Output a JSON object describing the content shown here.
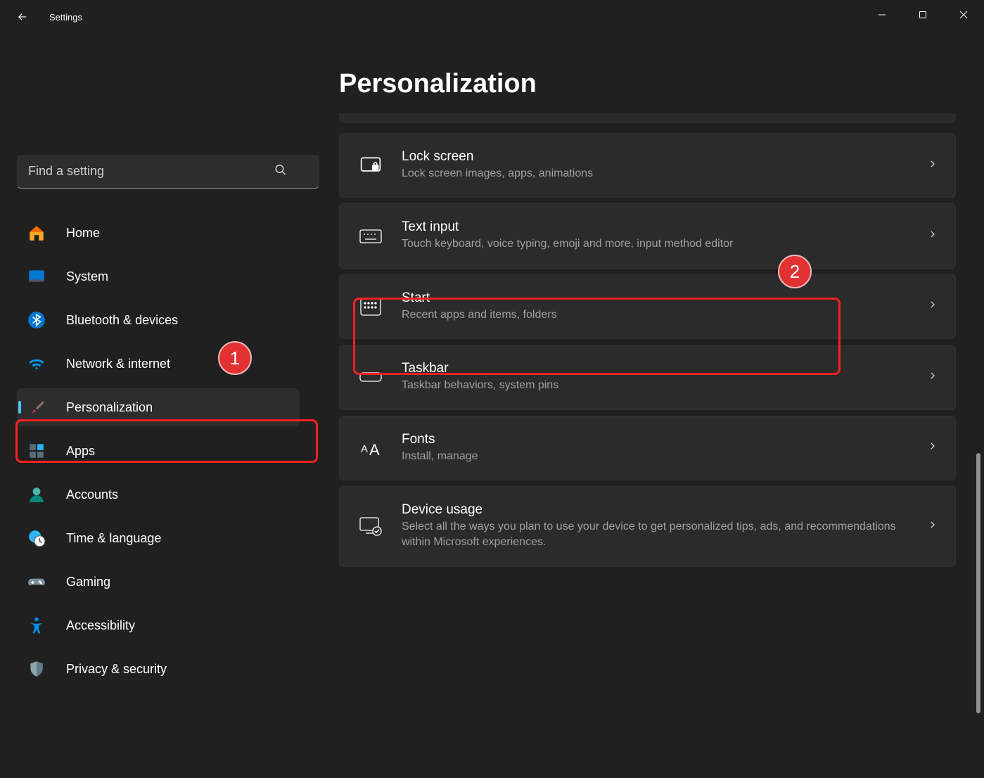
{
  "app": {
    "title": "Settings"
  },
  "search": {
    "placeholder": "Find a setting"
  },
  "sidebar": {
    "items": [
      {
        "label": "Home"
      },
      {
        "label": "System"
      },
      {
        "label": "Bluetooth & devices"
      },
      {
        "label": "Network & internet"
      },
      {
        "label": "Personalization"
      },
      {
        "label": "Apps"
      },
      {
        "label": "Accounts"
      },
      {
        "label": "Time & language"
      },
      {
        "label": "Gaming"
      },
      {
        "label": "Accessibility"
      },
      {
        "label": "Privacy & security"
      }
    ]
  },
  "page": {
    "title": "Personalization"
  },
  "cards": [
    {
      "title": "Lock screen",
      "sub": "Lock screen images, apps, animations"
    },
    {
      "title": "Text input",
      "sub": "Touch keyboard, voice typing, emoji and more, input method editor"
    },
    {
      "title": "Start",
      "sub": "Recent apps and items, folders"
    },
    {
      "title": "Taskbar",
      "sub": "Taskbar behaviors, system pins"
    },
    {
      "title": "Fonts",
      "sub": "Install, manage"
    },
    {
      "title": "Device usage",
      "sub": "Select all the ways you plan to use your device to get personalized tips, ads, and recommendations within Microsoft experiences."
    }
  ],
  "annotations": {
    "badge1": "1",
    "badge2": "2"
  }
}
